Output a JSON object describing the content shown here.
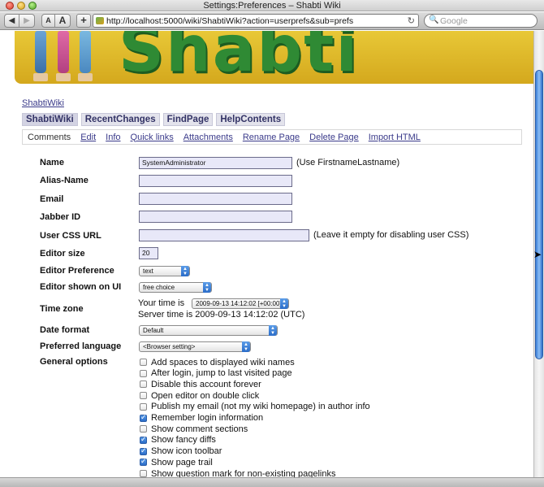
{
  "window": {
    "title": "Settings:Preferences – Shabti Wiki"
  },
  "toolbar": {
    "back": "◀",
    "forward": "▶",
    "text_smaller": "A",
    "text_larger": "A",
    "add": "+",
    "url": "http://localhost:5000/wiki/ShabtiWiki?action=userprefs&sub=prefs",
    "reload": "↻",
    "search_icon": "🔍",
    "search_placeholder": "Google"
  },
  "banner": {
    "logo_text": "Shabti"
  },
  "wiki": {
    "site_link": "ShabtiWiki",
    "tabs": [
      "ShabtiWiki",
      "RecentChanges",
      "FindPage",
      "HelpContents"
    ],
    "actions": [
      "Comments",
      "Edit",
      "Info",
      "Quick links",
      "Attachments",
      "Rename Page",
      "Delete Page",
      "Import HTML"
    ]
  },
  "form": {
    "name_label": "Name",
    "name_value": "SystemAdministrator",
    "name_hint": "(Use FirstnameLastname)",
    "alias_label": "Alias-Name",
    "alias_value": "",
    "email_label": "Email",
    "email_value": "",
    "jabber_label": "Jabber ID",
    "jabber_value": "",
    "css_label": "User CSS URL",
    "css_value": "",
    "css_hint": "(Leave it empty for disabling user CSS)",
    "editor_size_label": "Editor size",
    "editor_size_value": "20",
    "editor_pref_label": "Editor Preference",
    "editor_pref_value": "text",
    "editor_ui_label": "Editor shown on UI",
    "editor_ui_value": "free choice",
    "timezone_label": "Time zone",
    "your_time_label": "Your time is",
    "your_time_value": "2009-09-13 14:12:02 [+00:00]",
    "server_time": "Server time is 2009-09-13 14:12:02 (UTC)",
    "date_format_label": "Date format",
    "date_format_value": "Default",
    "language_label": "Preferred language",
    "language_value": "<Browser setting>",
    "general_label": "General options"
  },
  "options": [
    {
      "label": "Add spaces to displayed wiki names",
      "checked": false
    },
    {
      "label": "After login, jump to last visited page",
      "checked": false
    },
    {
      "label": "Disable this account forever",
      "checked": false
    },
    {
      "label": "Open editor on double click",
      "checked": false
    },
    {
      "label": "Publish my email (not my wiki homepage) in author info",
      "checked": false
    },
    {
      "label": "Remember login information",
      "checked": true
    },
    {
      "label": "Show comment sections",
      "checked": false
    },
    {
      "label": "Show fancy diffs",
      "checked": true
    },
    {
      "label": "Show icon toolbar",
      "checked": true
    },
    {
      "label": "Show page trail",
      "checked": true
    },
    {
      "label": "Show question mark for non-existing pagelinks",
      "checked": false
    }
  ]
}
